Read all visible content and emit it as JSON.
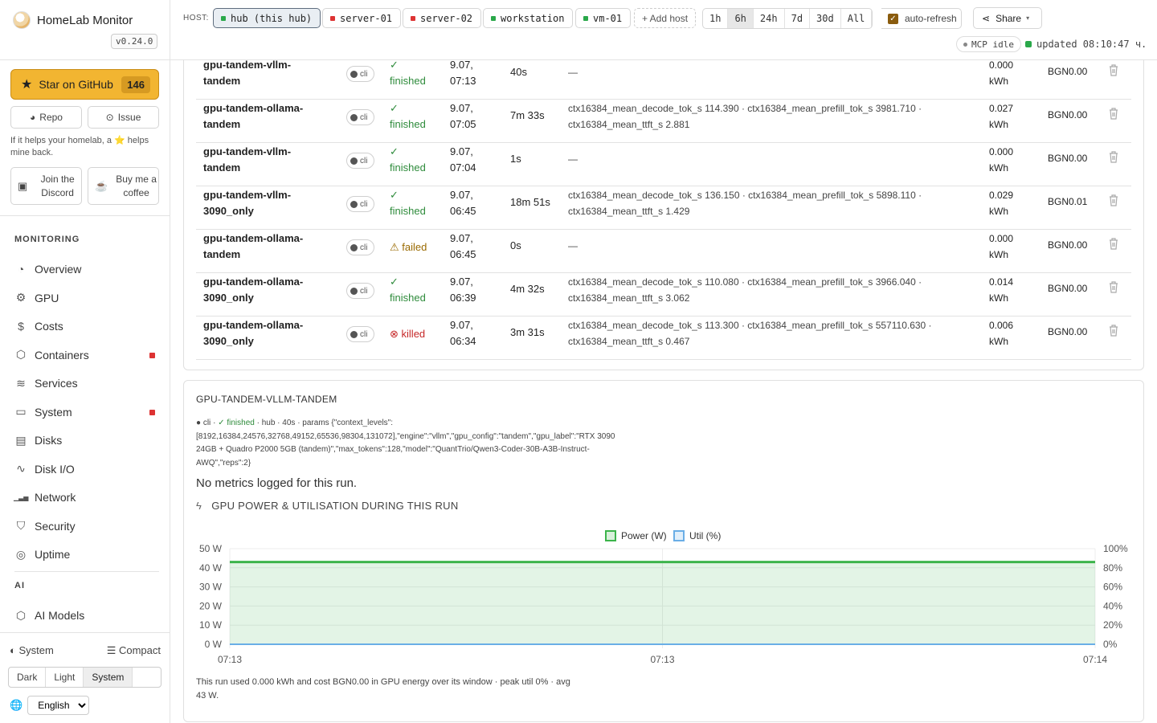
{
  "app": {
    "title": "HomeLab Monitor",
    "version": "v0.24.0"
  },
  "sidebar": {
    "star": {
      "label": "Star on GitHub",
      "count": "146"
    },
    "repo_label": "Repo",
    "issue_label": "Issue",
    "help_text": "If it helps your homelab, a ⭐ helps mine back.",
    "discord_label": "Join the Discord",
    "coffee_label": "Buy me a coffee",
    "monitoring_heading": "MONITORING",
    "nav": [
      {
        "label": "Overview",
        "icon": "gauge-icon",
        "alert": false
      },
      {
        "label": "GPU",
        "icon": "cpu-icon",
        "alert": false
      },
      {
        "label": "Costs",
        "icon": "coin-icon",
        "alert": false
      },
      {
        "label": "Containers",
        "icon": "box-icon",
        "alert": true
      },
      {
        "label": "Services",
        "icon": "layers-icon",
        "alert": false
      },
      {
        "label": "System",
        "icon": "monitor-icon",
        "alert": true
      },
      {
        "label": "Disks",
        "icon": "disk-icon",
        "alert": false
      },
      {
        "label": "Disk I/O",
        "icon": "activity-icon",
        "alert": false
      },
      {
        "label": "Network",
        "icon": "signal-icon",
        "alert": false
      },
      {
        "label": "Security",
        "icon": "shield-icon",
        "alert": false
      },
      {
        "label": "Uptime",
        "icon": "radar-icon",
        "alert": false
      }
    ],
    "ai_heading": "AI",
    "ai_nav": [
      {
        "label": "AI Models",
        "icon": "cube-icon"
      }
    ],
    "theme_label": "System",
    "compact_label": "Compact",
    "theme_options": [
      "Dark",
      "Light",
      "System"
    ],
    "theme_selected": "System",
    "language": "English"
  },
  "topbar": {
    "host_label": "HOST:",
    "hosts": [
      {
        "label": "hub (this hub)",
        "status_color": "#2aa84a",
        "active": true
      },
      {
        "label": "server-01",
        "status_color": "#d33",
        "active": false
      },
      {
        "label": "server-02",
        "status_color": "#d33",
        "active": false
      },
      {
        "label": "workstation",
        "status_color": "#2aa84a",
        "active": false
      },
      {
        "label": "vm-01",
        "status_color": "#2aa84a",
        "active": false
      }
    ],
    "add_host": "+ Add host",
    "ranges": [
      "1h",
      "6h",
      "24h",
      "7d",
      "30d",
      "All"
    ],
    "range_selected": "6h",
    "auto_refresh": "auto-refresh",
    "share": "Share",
    "mcp_status": "MCP idle",
    "updated": "updated 08:10:47 ч."
  },
  "runs": [
    {
      "name": "gpu-tandem-vllm-tandem",
      "source": "cli",
      "status": "finished",
      "started": "9.07, 07:13",
      "duration": "40s",
      "metrics": "—",
      "energy": "0.000 kWh",
      "cost": "BGN0.00"
    },
    {
      "name": "gpu-tandem-ollama-tandem",
      "source": "cli",
      "status": "finished",
      "started": "9.07, 07:05",
      "duration": "7m 33s",
      "metrics": "ctx16384_mean_decode_tok_s 114.390 · ctx16384_mean_prefill_tok_s 3981.710 · ctx16384_mean_ttft_s 2.881",
      "energy": "0.027 kWh",
      "cost": "BGN0.00"
    },
    {
      "name": "gpu-tandem-vllm-tandem",
      "source": "cli",
      "status": "finished",
      "started": "9.07, 07:04",
      "duration": "1s",
      "metrics": "—",
      "energy": "0.000 kWh",
      "cost": "BGN0.00"
    },
    {
      "name": "gpu-tandem-vllm-3090_only",
      "source": "cli",
      "status": "finished",
      "started": "9.07, 06:45",
      "duration": "18m 51s",
      "metrics": "ctx16384_mean_decode_tok_s 136.150 · ctx16384_mean_prefill_tok_s 5898.110 · ctx16384_mean_ttft_s 1.429",
      "energy": "0.029 kWh",
      "cost": "BGN0.01"
    },
    {
      "name": "gpu-tandem-ollama-tandem",
      "source": "cli",
      "status": "failed",
      "started": "9.07, 06:45",
      "duration": "0s",
      "metrics": "—",
      "energy": "0.000 kWh",
      "cost": "BGN0.00"
    },
    {
      "name": "gpu-tandem-ollama-3090_only",
      "source": "cli",
      "status": "finished",
      "started": "9.07, 06:39",
      "duration": "4m 32s",
      "metrics": "ctx16384_mean_decode_tok_s 110.080 · ctx16384_mean_prefill_tok_s 3966.040 · ctx16384_mean_ttft_s 3.062",
      "energy": "0.014 kWh",
      "cost": "BGN0.00"
    },
    {
      "name": "gpu-tandem-ollama-3090_only",
      "source": "cli",
      "status": "killed",
      "started": "9.07, 06:34",
      "duration": "3m 31s",
      "metrics": "ctx16384_mean_decode_tok_s 113.300 · ctx16384_mean_prefill_tok_s 557110.630 · ctx16384_mean_ttft_s 0.467",
      "energy": "0.006 kWh",
      "cost": "BGN0.00"
    }
  ],
  "detail": {
    "title": "GPU-TANDEM-VLLM-TANDEM",
    "meta_source": "cli",
    "meta_status": "finished",
    "meta_rest": "· hub · 40s · params {\"context_levels\":[8192,16384,24576,32768,49152,65536,98304,131072],\"engine\":\"vllm\",\"gpu_config\":\"tandem\",\"gpu_label\":\"RTX 3090 24GB + Quadro P2000 5GB (tandem)\",\"max_tokens\":128,\"model\":\"QuantTrio/Qwen3-Coder-30B-A3B-Instruct-AWQ\",\"reps\":2}",
    "no_metrics": "No metrics logged for this run.",
    "gpu_heading": "GPU POWER & UTILISATION DURING THIS RUN",
    "summary": "This run used 0.000 kWh and cost BGN0.00 in GPU energy over its window · peak util 0% · avg 43 W."
  },
  "chart_data": {
    "type": "line",
    "legend": "top-center",
    "x": [
      "07:13",
      "07:13",
      "07:14"
    ],
    "series": [
      {
        "name": "Power (W)",
        "axis": "left",
        "color": "#3cb44b",
        "fill": true,
        "values": [
          43,
          43,
          43
        ]
      },
      {
        "name": "Util (%)",
        "axis": "right",
        "color": "#6aaee6",
        "fill": false,
        "values": [
          0,
          0,
          0
        ]
      }
    ],
    "y_left": {
      "ticks": [
        "0 W",
        "10 W",
        "20 W",
        "30 W",
        "40 W",
        "50 W"
      ],
      "range": [
        0,
        50
      ]
    },
    "y_right": {
      "ticks": [
        "0%",
        "20%",
        "40%",
        "60%",
        "80%",
        "100%"
      ],
      "range": [
        0,
        100
      ]
    },
    "x_ticks": [
      "07:13",
      "07:13",
      "07:14"
    ],
    "grid": true
  }
}
